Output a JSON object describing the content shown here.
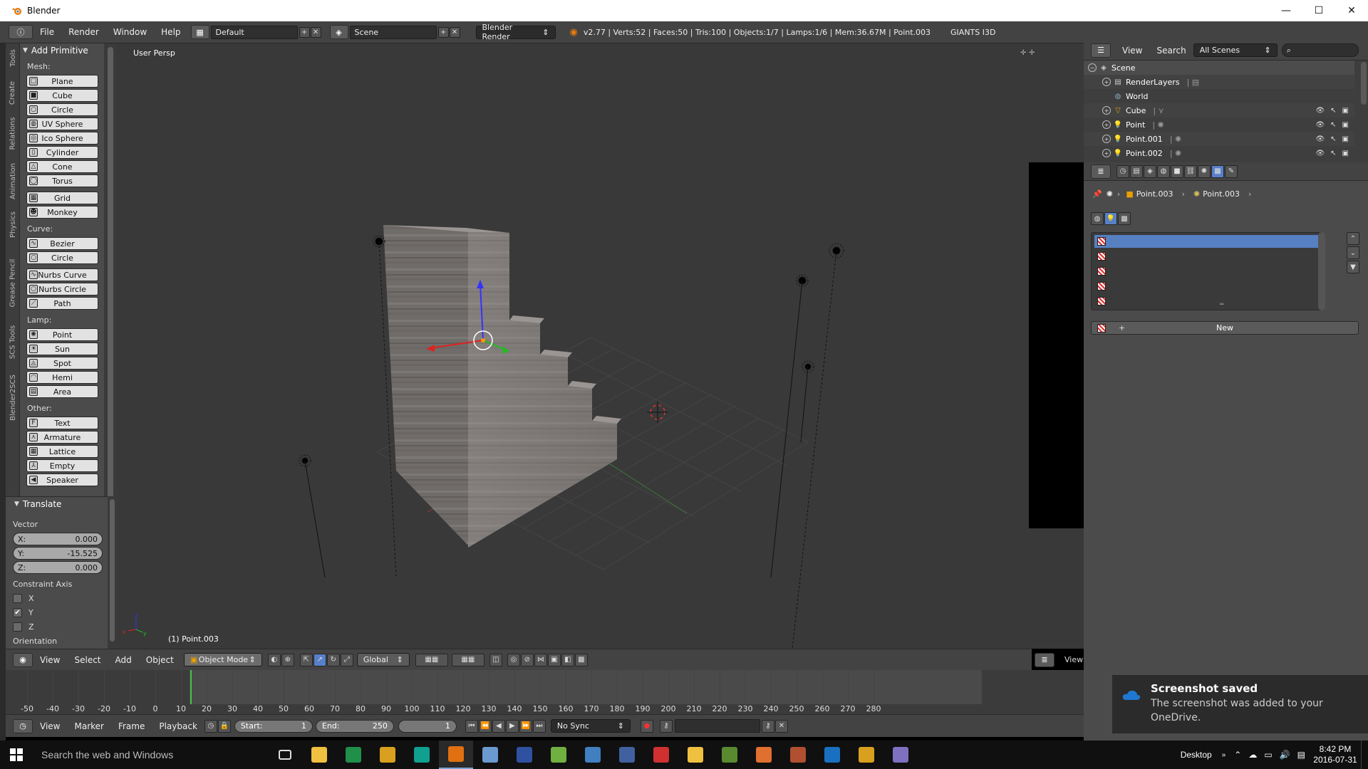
{
  "window": {
    "title": "Blender",
    "buttons": [
      "—",
      "☐",
      "✕"
    ]
  },
  "infobar": {
    "menus": [
      "File",
      "Render",
      "Window",
      "Help"
    ],
    "layout": "Default",
    "scene": "Scene",
    "engine": "Blender Render",
    "stats": "v2.77 | Verts:52 | Faces:50 | Tris:100 | Objects:1/7 | Lamps:1/6 | Mem:36.67M | Point.003",
    "addon": "GIANTS I3D"
  },
  "vtabs": [
    "Tools",
    "Create",
    "Relations",
    "Animation",
    "Physics",
    "Grease Pencil",
    "SCS Tools",
    "Blender2SCS"
  ],
  "tools": {
    "add_primitive": "Add Primitive",
    "mesh_label": "Mesh:",
    "mesh": [
      "Plane",
      "Cube",
      "Circle",
      "UV Sphere",
      "Ico Sphere",
      "Cylinder",
      "Cone",
      "Torus"
    ],
    "mesh2": [
      "Grid",
      "Monkey"
    ],
    "curve_label": "Curve:",
    "curve": [
      "Bezier",
      "Circle"
    ],
    "curve2": [
      "Nurbs Curve",
      "Nurbs Circle",
      "Path"
    ],
    "lamp_label": "Lamp:",
    "lamp": [
      "Point",
      "Sun",
      "Spot",
      "Hemi",
      "Area"
    ],
    "other_label": "Other:",
    "other": [
      "Text",
      "Armature",
      "Lattice",
      "Empty",
      "Speaker"
    ]
  },
  "translate": {
    "title": "Translate",
    "vector_label": "Vector",
    "x_label": "X:",
    "x": "0.000",
    "y_label": "Y:",
    "y": "-15.525",
    "z_label": "Z:",
    "z": "0.000",
    "constraint_label": "Constraint Axis",
    "axes": [
      {
        "name": "X",
        "checked": false
      },
      {
        "name": "Y",
        "checked": true
      },
      {
        "name": "Z",
        "checked": false
      }
    ],
    "orientation_label": "Orientation"
  },
  "viewport": {
    "view_label": "User Persp",
    "object_label": "(1) Point.003"
  },
  "vpheader": {
    "menus": [
      "View",
      "Select",
      "Add",
      "Object"
    ],
    "mode": "Object Mode",
    "orientation": "Global",
    "right_view": "View"
  },
  "timeline": {
    "ticks": [
      "-50",
      "-40",
      "-30",
      "-20",
      "-10",
      "0",
      "10",
      "20",
      "30",
      "40",
      "50",
      "60",
      "70",
      "80",
      "90",
      "100",
      "110",
      "120",
      "130",
      "140",
      "150",
      "160",
      "170",
      "180",
      "190",
      "200",
      "210",
      "220",
      "230",
      "240",
      "250",
      "260",
      "270",
      "280"
    ],
    "menus": [
      "View",
      "Marker",
      "Frame",
      "Playback"
    ],
    "start_label": "Start:",
    "start": "1",
    "end_label": "End:",
    "end": "250",
    "current": "1",
    "sync": "No Sync"
  },
  "outliner": {
    "menus": [
      "View",
      "Search"
    ],
    "filter": "All Scenes",
    "rows": [
      {
        "name": "Scene",
        "icon": "scene-icon",
        "indent": 0
      },
      {
        "name": "RenderLayers",
        "icon": "renderlayers-icon",
        "indent": 1
      },
      {
        "name": "World",
        "icon": "world-icon",
        "indent": 1
      },
      {
        "name": "Cube",
        "icon": "mesh-icon",
        "indent": 1
      },
      {
        "name": "Point",
        "icon": "lamp-icon",
        "indent": 1
      },
      {
        "name": "Point.001",
        "icon": "lamp-icon",
        "indent": 1
      },
      {
        "name": "Point.002",
        "icon": "lamp-icon",
        "indent": 1
      }
    ]
  },
  "properties": {
    "breadcrumb_object": "Point.003",
    "breadcrumb_data": "Point.003",
    "new_button": "New"
  },
  "toast": {
    "title": "Screenshot saved",
    "body": "The screenshot was added to your OneDrive."
  },
  "taskbar": {
    "search": "Search the web and Windows",
    "desktop": "Desktop",
    "time": "8:42 PM",
    "date": "2016-07-31",
    "apps": [
      "#f0c040",
      "#1f8f4a",
      "#d9a020",
      "#10a090",
      "#e07010",
      "#6a9ad0",
      "#3050a0",
      "#70b040",
      "#4080c0",
      "#4060a0",
      "#d03030",
      "#f0c040",
      "#5a8a30",
      "#e07030",
      "#b05030",
      "#1a70c0",
      "#d9a020",
      "#8070c0"
    ]
  }
}
